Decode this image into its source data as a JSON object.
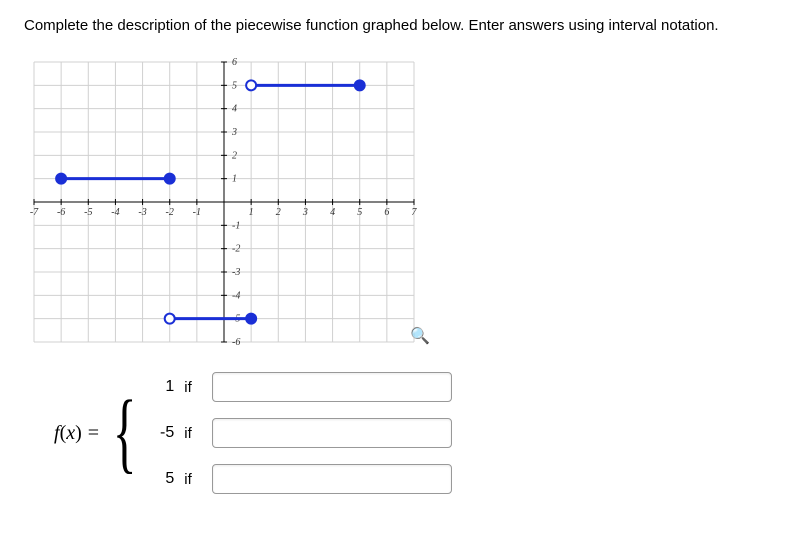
{
  "prompt": "Complete the description of the piecewise function graphed below. Enter answers using interval notation.",
  "chart_data": {
    "type": "piecewise-plot",
    "xlim": [
      -7,
      7
    ],
    "ylim": [
      -6,
      6
    ],
    "grid": true,
    "x_ticks": [
      -7,
      -6,
      -5,
      -4,
      -3,
      -2,
      -1,
      1,
      2,
      3,
      4,
      5,
      6,
      7
    ],
    "y_ticks": [
      -6,
      -5,
      -4,
      -3,
      -2,
      -1,
      1,
      2,
      3,
      4,
      5,
      6
    ],
    "segments": [
      {
        "y": 1,
        "x_from": -6,
        "x_to": -2,
        "left_closed": true,
        "right_closed": true
      },
      {
        "y": -5,
        "x_from": -2,
        "x_to": 1,
        "left_closed": false,
        "right_closed": true
      },
      {
        "y": 5,
        "x_from": 1,
        "x_to": 5,
        "left_closed": false,
        "right_closed": true
      }
    ]
  },
  "fx_label": {
    "f": "f",
    "x": "x"
  },
  "equals": "=",
  "cases": [
    {
      "value": "1",
      "if": "if",
      "answer": ""
    },
    {
      "value": "-5",
      "if": "if",
      "answer": ""
    },
    {
      "value": "5",
      "if": "if",
      "answer": ""
    }
  ]
}
